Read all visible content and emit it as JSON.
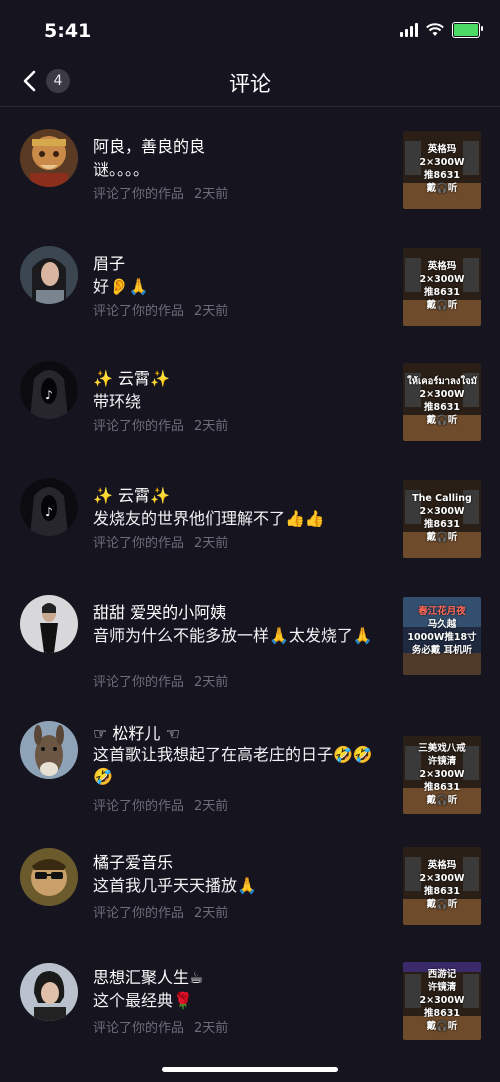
{
  "status": {
    "time": "5:41"
  },
  "nav": {
    "count": "4",
    "title": "评论"
  },
  "comments": [
    {
      "name": "阿良，善良的良",
      "text": "谜。。。。",
      "action": "评论了你的作品",
      "time": "2天前",
      "thumb": [
        "英格玛",
        "2×300W",
        "推8631",
        "戴🎧听"
      ]
    },
    {
      "name": "眉子",
      "text": "好👂🙏",
      "action": "评论了你的作品",
      "time": "2天前",
      "thumb": [
        "英格玛",
        "2×300W",
        "推8631",
        "戴🎧听"
      ]
    },
    {
      "name": "✨ 云霄✨",
      "text": "带环绕",
      "action": "评论了你的作品",
      "time": "2天前",
      "thumb": [
        "ให้เคอร์มาลงใจมั",
        "2×300W",
        "推8631",
        "戴🎧听"
      ]
    },
    {
      "name": "✨ 云霄✨",
      "text": "发烧友的世界他们理解不了👍👍",
      "action": "评论了你的作品",
      "time": "2天前",
      "thumb": [
        "The Calling",
        "2×300W",
        "推8631",
        "戴🎧听"
      ]
    },
    {
      "name": "甜甜 爱哭的小阿姨",
      "text": "音师为什么不能多放一样🙏太发烧了🙏",
      "action": "评论了你的作品",
      "time": "2天前",
      "thumb": [
        "春江花月夜",
        "马久越",
        "1000W推18寸",
        "务必戴  耳机听"
      ]
    },
    {
      "name": "☞ 松籽儿 ☜",
      "text": "这首歌让我想起了在高老庄的日子🤣🤣🤣",
      "action": "评论了你的作品",
      "time": "2天前",
      "thumb": [
        "三美戏八戒",
        "许镜清",
        "2×300W",
        "推8631",
        "戴🎧听"
      ]
    },
    {
      "name": "橘子爱音乐",
      "text": "这首我几乎天天播放🙏",
      "action": "评论了你的作品",
      "time": "2天前",
      "thumb": [
        "英格玛",
        "2×300W",
        "推8631",
        "戴🎧听"
      ]
    },
    {
      "name": "思想汇聚人生☕",
      "text": "这个最经典🌹",
      "action": "评论了你的作品",
      "time": "2天前",
      "thumb": [
        "西游记",
        "许镜清",
        "2×300W",
        "推8631",
        "戴🎧听"
      ]
    }
  ],
  "icons": {
    "back": "chevron-left-icon",
    "wifi": "wifi-icon",
    "signal": "signal-icon",
    "battery": "battery-icon",
    "avatars": [
      "avatar-cartoon-monkey-king",
      "avatar-woman-long-hair",
      "avatar-dark-hood-logo",
      "avatar-dark-hood-logo",
      "avatar-woman-black-dress",
      "avatar-donkey",
      "avatar-cartoon-sunglasses",
      "avatar-woman-portrait"
    ]
  },
  "colors": {
    "background": "#15141f",
    "meta_text": "#6d6c78",
    "badge": "#3b3a45",
    "battery": "#4cd964"
  }
}
